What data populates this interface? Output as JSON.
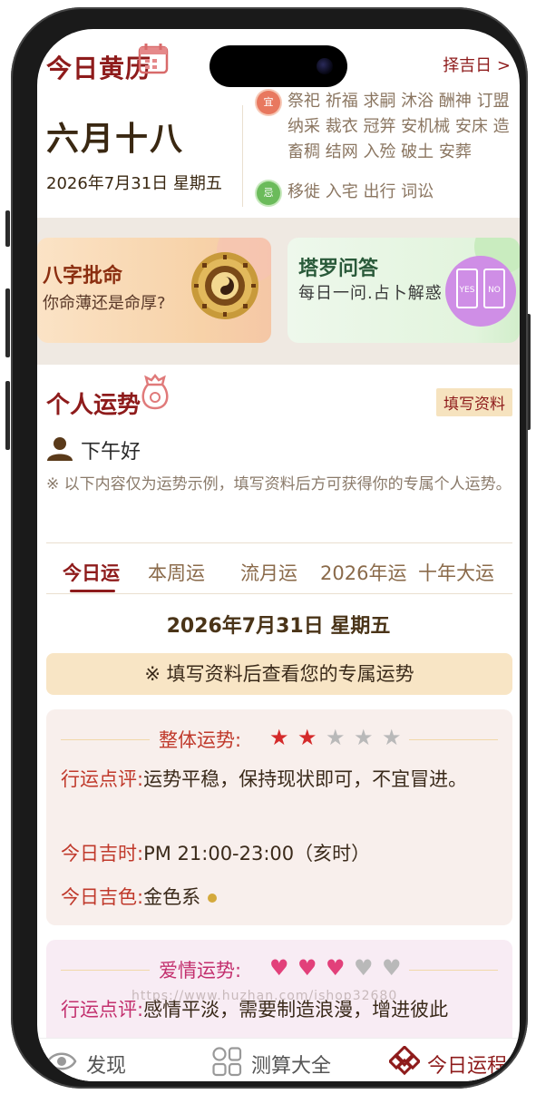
{
  "header": {
    "app_title": "今日黄历",
    "calendar_icon": "calendar-icon",
    "zeji_link": "择吉日 >"
  },
  "today": {
    "lunar_date": "六月十八",
    "solar_date": "2026年7月31日 星期五"
  },
  "almanac": {
    "yi_badge": "宜",
    "yi_text": "祭祀 祈福 求嗣 沐浴 酬神 订盟 纳采 裁衣 冠笄 安机械 安床 造畜稠 结网 入殓 破土 安葬",
    "ji_badge": "忌",
    "ji_text": "移徙 入宅 出行 词讼"
  },
  "promo": {
    "bazi": {
      "title": "八字批命",
      "subtitle": "你命薄还是命厚?",
      "image": "bagua-compass-image"
    },
    "tarot": {
      "title": "塔罗问答",
      "subtitle": "每日一问.占卜解惑",
      "card_yes": "YES",
      "card_no": "NO"
    }
  },
  "personal": {
    "title": "个人运势",
    "fill_button": "填写资料",
    "greeting": "下午好",
    "notice": "※ 以下内容仅为运势示例，填写资料后方可获得你的专属个人运势。",
    "tabs": [
      "今日运",
      "本周运",
      "流月运",
      "2026年运",
      "十年大运"
    ],
    "active_tab": 0,
    "date": "2026年7月31日 星期五",
    "banner": "※ 填写资料后查看您的专属运势"
  },
  "overall": {
    "label": "整体运势:",
    "rating": 2,
    "max_rating": 5,
    "star_on_color": "#d42a2a",
    "star_off_color": "#b9b9b9",
    "review_key": "行运点评:",
    "review_value": "运势平稳，保持现状即可，不宜冒进。",
    "time_key": "今日吉时:",
    "time_value": "PM 21:00-23:00（亥时）",
    "color_key": "今日吉色:",
    "color_value": "金色系",
    "lucky_color": "#d4a93b"
  },
  "love": {
    "label": "爱情运势:",
    "rating": 3,
    "max_rating": 5,
    "heart_on_color": "#e2407a",
    "heart_off_color": "#b9b9b9",
    "review_key": "行运点评:",
    "review_value": "感情平淡，需要制造浪漫，增进彼此"
  },
  "watermark": "https://www.huzhan.com/ishop32680",
  "nav": [
    {
      "label": "发现",
      "icon": "eye-icon"
    },
    {
      "label": "测算大全",
      "icon": "grid-icon"
    },
    {
      "label": "今日运程",
      "icon": "chinese-knot-icon"
    }
  ],
  "nav_active": 2,
  "colors": {
    "brand_red": "#8e1b1b",
    "accent_gold": "#f6e3bf"
  }
}
